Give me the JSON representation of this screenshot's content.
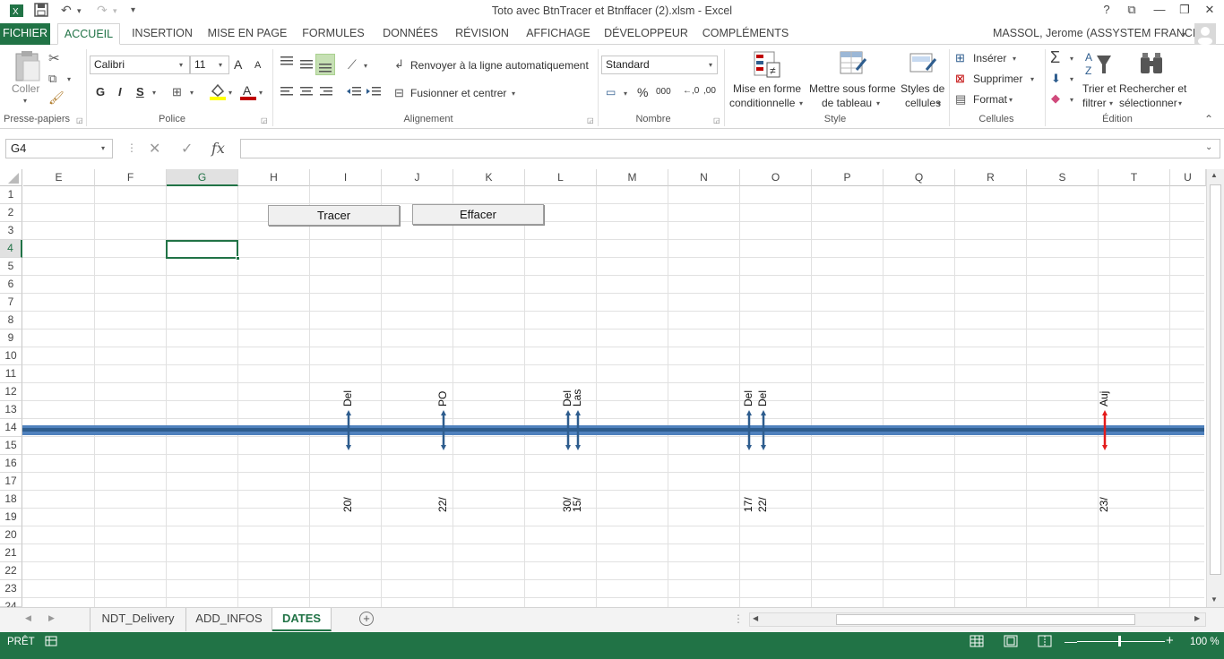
{
  "window": {
    "title": "Toto avec BtnTracer et Btnffacer (2).xlsm - Excel",
    "help": "?",
    "restore_ribbon": "⧉",
    "minimize": "—",
    "maximize": "❐",
    "close": "✕"
  },
  "qat": {
    "save_icon": "save-icon",
    "undo_icon": "undo-icon",
    "redo_icon": "redo-icon",
    "customize": "▾"
  },
  "tabs": [
    "FICHIER",
    "ACCUEIL",
    "INSERTION",
    "MISE EN PAGE",
    "FORMULES",
    "DONNÉES",
    "RÉVISION",
    "AFFICHAGE",
    "DÉVELOPPEUR",
    "COMPLÉMENTS"
  ],
  "user": "MASSOL, Jerome (ASSYSTEM FRANCE)",
  "ribbon": {
    "clipboard": {
      "paste": "Coller",
      "group": "Presse-papiers"
    },
    "font": {
      "name": "Calibri",
      "size": "11",
      "bold": "G",
      "italic": "I",
      "underline": "S",
      "grow": "A",
      "shrink": "A",
      "group": "Police",
      "font_color": "#c00000",
      "fill_color": "#ffff00"
    },
    "alignment": {
      "wrap": "Renvoyer à la ligne automatiquement",
      "merge": "Fusionner et centrer",
      "group": "Alignement"
    },
    "number": {
      "format": "Standard",
      "percent": "%",
      "thousands": "000",
      "group": "Nombre"
    },
    "style": {
      "conditional": "Mise en forme",
      "conditional2": "conditionnelle",
      "table": "Mettre sous forme",
      "table2": "de tableau",
      "cell": "Styles de",
      "cell2": "cellules",
      "group": "Style"
    },
    "cells": {
      "insert": "Insérer",
      "delete": "Supprimer",
      "format": "Format",
      "group": "Cellules"
    },
    "edit": {
      "sort": "Trier et",
      "sort2": "filtrer",
      "find": "Rechercher et",
      "find2": "sélectionner",
      "group": "Édition",
      "sum": "Σ"
    }
  },
  "formula_bar": {
    "name_box": "G4",
    "cancel": "✕",
    "enter": "✓",
    "fx": "fx",
    "value": ""
  },
  "columns": [
    "E",
    "F",
    "G",
    "H",
    "I",
    "J",
    "K",
    "L",
    "M",
    "N",
    "O",
    "P",
    "Q",
    "R",
    "S",
    "T",
    "U"
  ],
  "selected_column": "G",
  "rows": [
    "1",
    "2",
    "3",
    "4",
    "5",
    "6",
    "7",
    "8",
    "9",
    "10",
    "11",
    "12",
    "13",
    "14",
    "15",
    "16",
    "17",
    "18",
    "19",
    "20",
    "21",
    "22",
    "23",
    "24"
  ],
  "selected_row": "4",
  "buttons": {
    "tracer": "Tracer",
    "effacer": "Effacer"
  },
  "timeline": {
    "bar_color": "#4f81bd",
    "arrow_color": "#2e5d8e",
    "today_color": "#e31b1b",
    "markers": [
      {
        "top": "Del",
        "bottom": "20/"
      },
      {
        "top": "PO",
        "bottom": "22/"
      },
      {
        "top": "Del",
        "bottom": "30/"
      },
      {
        "top": "Las",
        "bottom": "15/"
      },
      {
        "top": "Del",
        "bottom": "17/"
      },
      {
        "top": "Del",
        "bottom": "22/"
      },
      {
        "top": "Auj",
        "bottom": "23/"
      }
    ]
  },
  "sheets": [
    "NDT_Delivery",
    "ADD_INFOS",
    "DATES"
  ],
  "active_sheet": "DATES",
  "status": {
    "mode": "PRÊT",
    "zoom": "100 %"
  }
}
